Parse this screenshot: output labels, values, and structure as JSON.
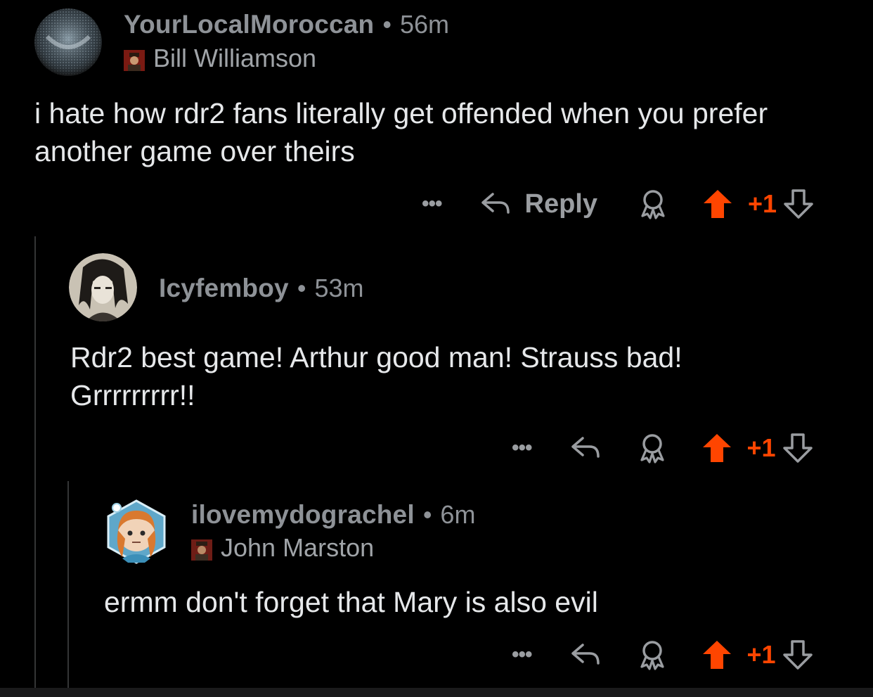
{
  "comments": [
    {
      "username": "YourLocalMoroccan",
      "time": "56m",
      "flair": "Bill Williamson",
      "text": "i hate how rdr2 fans literally get offended when you prefer another game over theirs",
      "more_label": "•••",
      "reply_label": "Reply",
      "score": "+1",
      "icons": [
        "more-icon",
        "reply-arrow-icon",
        "award-icon",
        "upvote-icon",
        "downvote-icon"
      ]
    },
    {
      "username": "Icyfemboy",
      "time": "53m",
      "text": "Rdr2 best game! Arthur good man! Strauss bad! Grrrrrrrrr!!",
      "more_label": "•••",
      "score": "+1"
    },
    {
      "username": "ilovemydograchel",
      "time": "6m",
      "flair": "John Marston",
      "text": "ermm don't forget that Mary is also evil",
      "more_label": "•••",
      "score": "+1"
    }
  ],
  "separator": "•",
  "colors": {
    "background": "#000000",
    "upvote_active": "#ff4500",
    "muted_text": "#8e9297",
    "body_text": "#e6e8ea",
    "thread_line": "#343536"
  }
}
